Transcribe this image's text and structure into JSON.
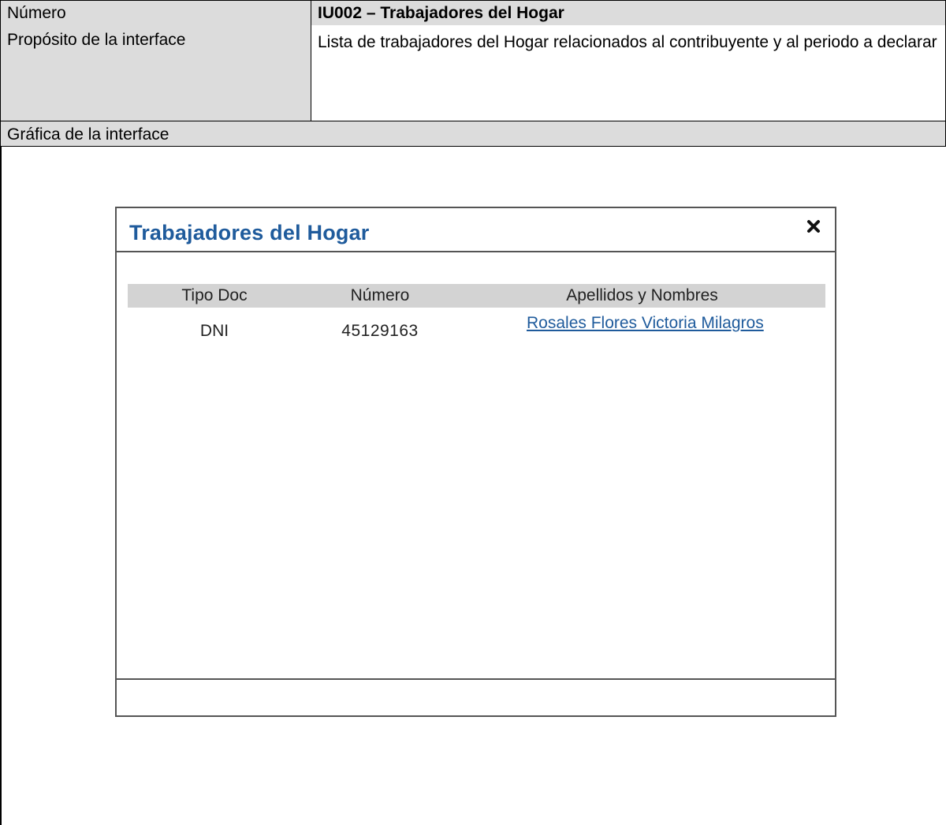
{
  "spec": {
    "rows": [
      {
        "label": "Número",
        "value": "IU002 – Trabajadores del Hogar"
      },
      {
        "label": "Propósito de la interface",
        "value": "Lista de trabajadores del Hogar relacionados al contribuyente y al periodo a declarar"
      }
    ],
    "graphic_label": "Gráfica de la interface"
  },
  "dialog": {
    "title": "Trabajadores del Hogar",
    "close_icon": "close-icon",
    "table": {
      "headers": [
        "Tipo Doc",
        "Número",
        "Apellidos y Nombres"
      ],
      "rows": [
        [
          "DNI",
          "45129163",
          "Rosales Flores Victoria Milagros"
        ]
      ]
    }
  },
  "colors": {
    "header_gray": "#dcdcdc",
    "table_head_gray": "#d3d3d3",
    "title_blue": "#1f5b9c",
    "border": "#000000"
  }
}
